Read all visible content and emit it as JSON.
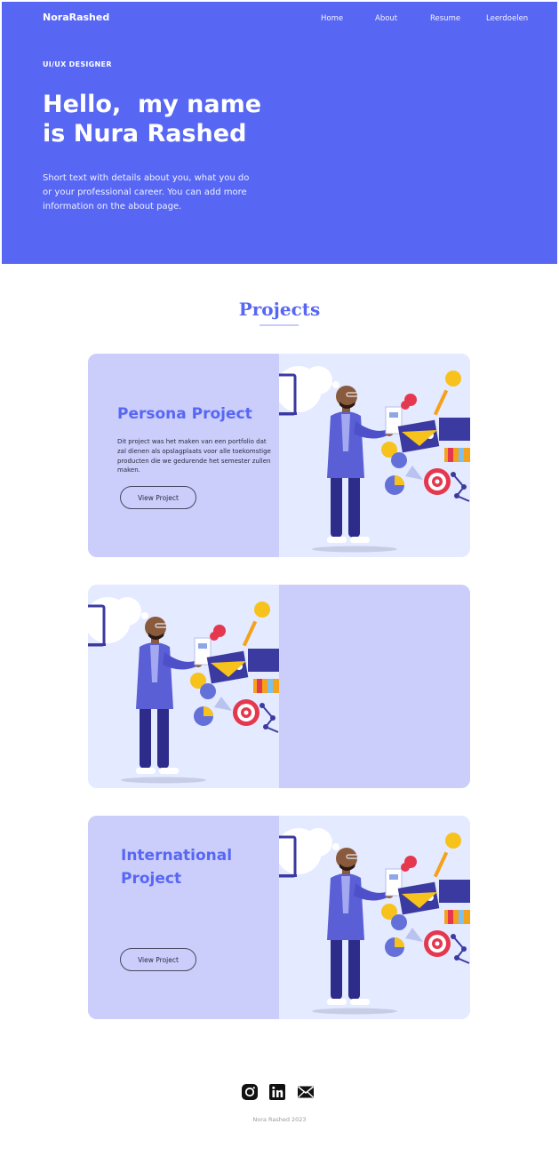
{
  "header": {
    "logo": "NoraRashed",
    "nav": [
      "Home",
      "About",
      "Resume",
      "Leerdoelen"
    ]
  },
  "hero": {
    "tag": "UI/UX DESIGNER",
    "headline_line1": "Hello,  my name",
    "headline_line2": "is Nura Rashed",
    "intro": "Short text with details about you, what you do or your professional career. You can add more information on the about page."
  },
  "projects_section": {
    "title": "Projects",
    "cards": [
      {
        "title": "Persona Project",
        "description": "Dit project was het  maken van een portfolio dat zal dienen als opslagplaats voor alle toekomstige producten die we gedurende het semester zullen maken.",
        "button": "View Project"
      },
      {
        "title": "",
        "description": "",
        "button": ""
      },
      {
        "title_line1": "International",
        "title_line2": "Project",
        "button": "View Project"
      }
    ]
  },
  "footer": {
    "icons": [
      "instagram-icon",
      "linkedin-icon",
      "mail-icon"
    ],
    "text": "Nora Rashed 2023"
  },
  "colors": {
    "brand": "#5767f4",
    "panel": "#cbcdfb",
    "art_background": "#e4eaff"
  }
}
